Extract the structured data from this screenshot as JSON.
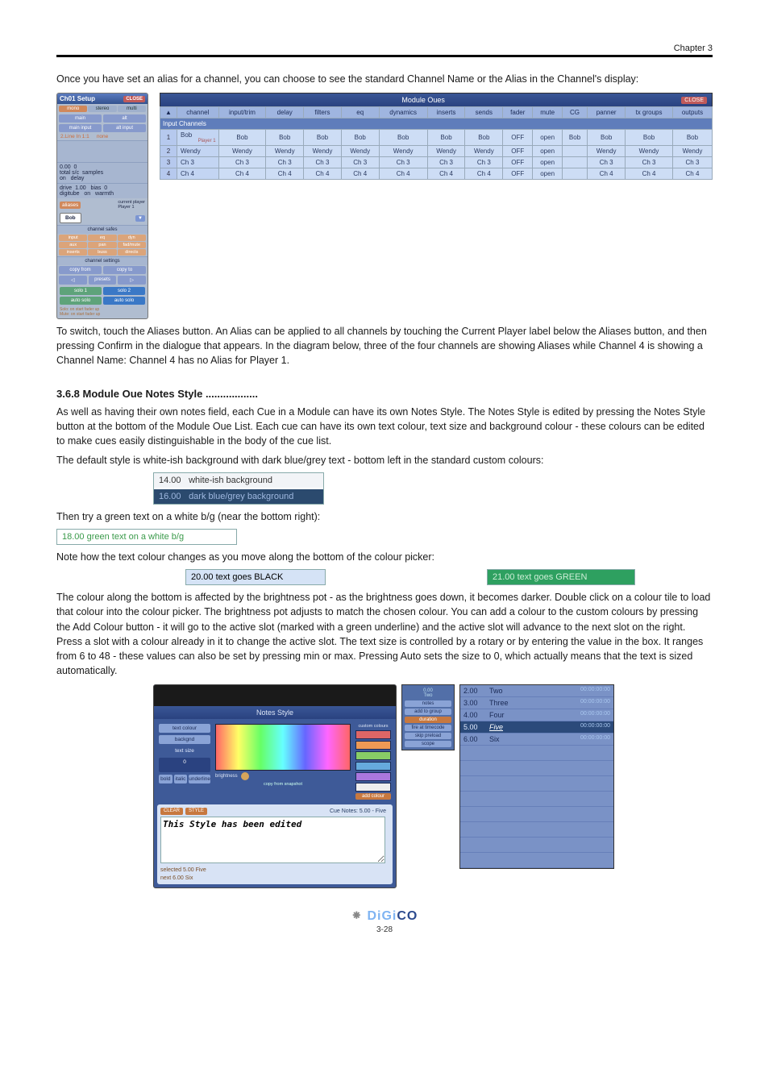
{
  "header": {
    "chapter": "Chapter 3"
  },
  "intro_top": [
    "Once you have set an alias for a channel, you can choose to see the standard Channel Name or the Alias in the Channel's display:"
  ],
  "aliases_tip": [
    "To switch, touch the Aliases button. An Alias can be applied to all channels by touching the Current Player label below the Aliases button, and then pressing Confirm in the dialogue that appears. In the diagram below, three of the four channels are showing Aliases while Channel 4 is showing a Channel Name: Channel 4 has no Alias for Player 1."
  ],
  "section_style": {
    "heading": "3.6.8 Module Oue Notes Style ..................",
    "p1": "As well as having their own notes field, each Cue in a Module can have its own Notes Style. The Notes Style is edited by pressing the Notes Style button at the bottom of the Module Oue List. Each cue can have its own text colour, text size and background colour - these colours can be edited to make cues easily distinguishable in the body of the cue list.",
    "p2": "The default style is white-ish background with dark blue/grey text - bottom left in the standard custom colours:"
  },
  "swatches": {
    "a_idx": "14.00",
    "a_txt": "white-ish background",
    "b_idx": "16.00",
    "b_txt": "dark blue/grey background",
    "c_idx": "18.00",
    "c_txt": "green text on a white b/g",
    "d_idx": "20.00",
    "d_txt": "text goes BLACK",
    "e_idx": "21.00",
    "e_txt": "text goes GREEN"
  },
  "between1": "Then try a green text on a white b/g (near the bottom right):",
  "between2": "Note how the text colour changes as you move along the bottom of the colour picker:",
  "between3": "The colour along the bottom is affected by the brightness pot - as the brightness goes down, it becomes darker. Double click on a colour tile to load that colour into the colour picker. The brightness pot adjusts to match the chosen colour. You can add a colour to the custom colours by pressing the Add Colour button - it will go to the active slot (marked with a green underline) and the active slot will advance to the next slot on the right. Press a slot with a colour already in it to change the active slot. The text size is controlled by a rotary or by entering the value in the box. It ranges from 6 to 48 - these values can also be set by pressing min or max. Pressing Auto sets the size to 0, which actually means that the text is sized automatically.",
  "chsetup": {
    "title": "Ch01 Setup",
    "close": "CLOSE",
    "tabs": [
      "mono",
      "stereo",
      "multi"
    ],
    "inbtns": [
      "main",
      "alt"
    ],
    "mainalt": [
      "main input",
      "alt input"
    ],
    "lineleft": "2.Line In 1:1",
    "lineright": "none",
    "totaldb": "0.00",
    "samples": "0",
    "labels": {
      "total": "total s/c",
      "samp": "samples",
      "on": "on",
      "delay": "delay",
      "drive": "drive",
      "bias": "bias",
      "digitube": "digitube",
      "warmth": "warmth"
    },
    "drive": "1.00",
    "biasv": "0",
    "aliases_btn": "aliases",
    "current_player": "current player\nPlayer 1",
    "alias_val": "Bob",
    "safes_hdr": "channel safes",
    "safes": [
      "input",
      "eq",
      "dyn",
      "aux",
      "pan",
      "fad/mute",
      "inserts",
      "buss",
      "directs"
    ],
    "settings_hdr": "channel settings",
    "copyfrom": "copy from",
    "copyto": "copy to",
    "presets": "presets",
    "solo1": "solo 1",
    "solo2": "solo 2",
    "autosolo": "auto solo",
    "mutesolo": "auto solo",
    "foot1": "Solo: on start fader up",
    "foot2": "Mute: on start fader up"
  },
  "mtable": {
    "title": "Module Oues",
    "close": "CLOSE",
    "cols": [
      "",
      "channel",
      "input/trim",
      "delay",
      "filters",
      "eq",
      "dynamics",
      "inserts",
      "sends",
      "fader",
      "mute",
      "CG",
      "panner",
      "tx groups",
      "outputs"
    ],
    "cat": "Input Channels",
    "rows": [
      {
        "n": "1",
        "name": "Bob",
        "sub": "Player 1",
        "cells": [
          "Bob",
          "Bob",
          "Bob",
          "Bob",
          "Bob",
          "Bob",
          "Bob",
          "OFF",
          "open",
          "Bob",
          "Bob",
          "Bob",
          "Bob"
        ]
      },
      {
        "n": "2",
        "name": "Wendy",
        "sub": "",
        "cells": [
          "Wendy",
          "Wendy",
          "Wendy",
          "Wendy",
          "Wendy",
          "Wendy",
          "Wendy",
          "OFF",
          "open",
          "",
          "Wendy",
          "Wendy",
          "Wendy"
        ]
      },
      {
        "n": "3",
        "name": "Ch 3",
        "sub": "",
        "cells": [
          "Ch 3",
          "Ch 3",
          "Ch 3",
          "Ch 3",
          "Ch 3",
          "Ch 3",
          "Ch 3",
          "OFF",
          "open",
          "",
          "Ch 3",
          "Ch 3",
          "Ch 3"
        ]
      },
      {
        "n": "4",
        "name": "Ch 4",
        "sub": "",
        "cells": [
          "Ch 4",
          "Ch 4",
          "Ch 4",
          "Ch 4",
          "Ch 4",
          "Ch 4",
          "Ch 4",
          "OFF",
          "open",
          "",
          "Ch 4",
          "Ch 4",
          "Ch 4"
        ]
      }
    ]
  },
  "notes": {
    "title": "Notes Style",
    "left": [
      "text colour",
      "backgnd",
      "text size",
      "bold",
      "italic",
      "underline"
    ],
    "brightness": "brightness",
    "copy": "copy from snapshot",
    "right_btn": "add colour",
    "custom": "custom colours",
    "lower_btns": [
      "CLEAR",
      "STYLE"
    ],
    "cue_label": "Cue Notes: 5.00 - Five",
    "textarea": "This Style has been edited",
    "selected": "selected 5.00  Five",
    "next": "next 6.00  Six",
    "side": {
      "top": "0.00\nTwo",
      "items": [
        "notes",
        "add to group",
        "duration",
        "fire at timecode",
        "skip preload",
        "scope"
      ],
      "on": 2
    },
    "list": [
      {
        "t": "2.00",
        "n": "Two"
      },
      {
        "t": "3.00",
        "n": "Three"
      },
      {
        "t": "4.00",
        "n": "Four"
      },
      {
        "t": "5.00",
        "n": "Five",
        "sel": true
      },
      {
        "t": "6.00",
        "n": "Six"
      }
    ]
  },
  "footer": {
    "brand_a": "DiGi",
    "brand_b": "CO",
    "page": "3-28"
  }
}
